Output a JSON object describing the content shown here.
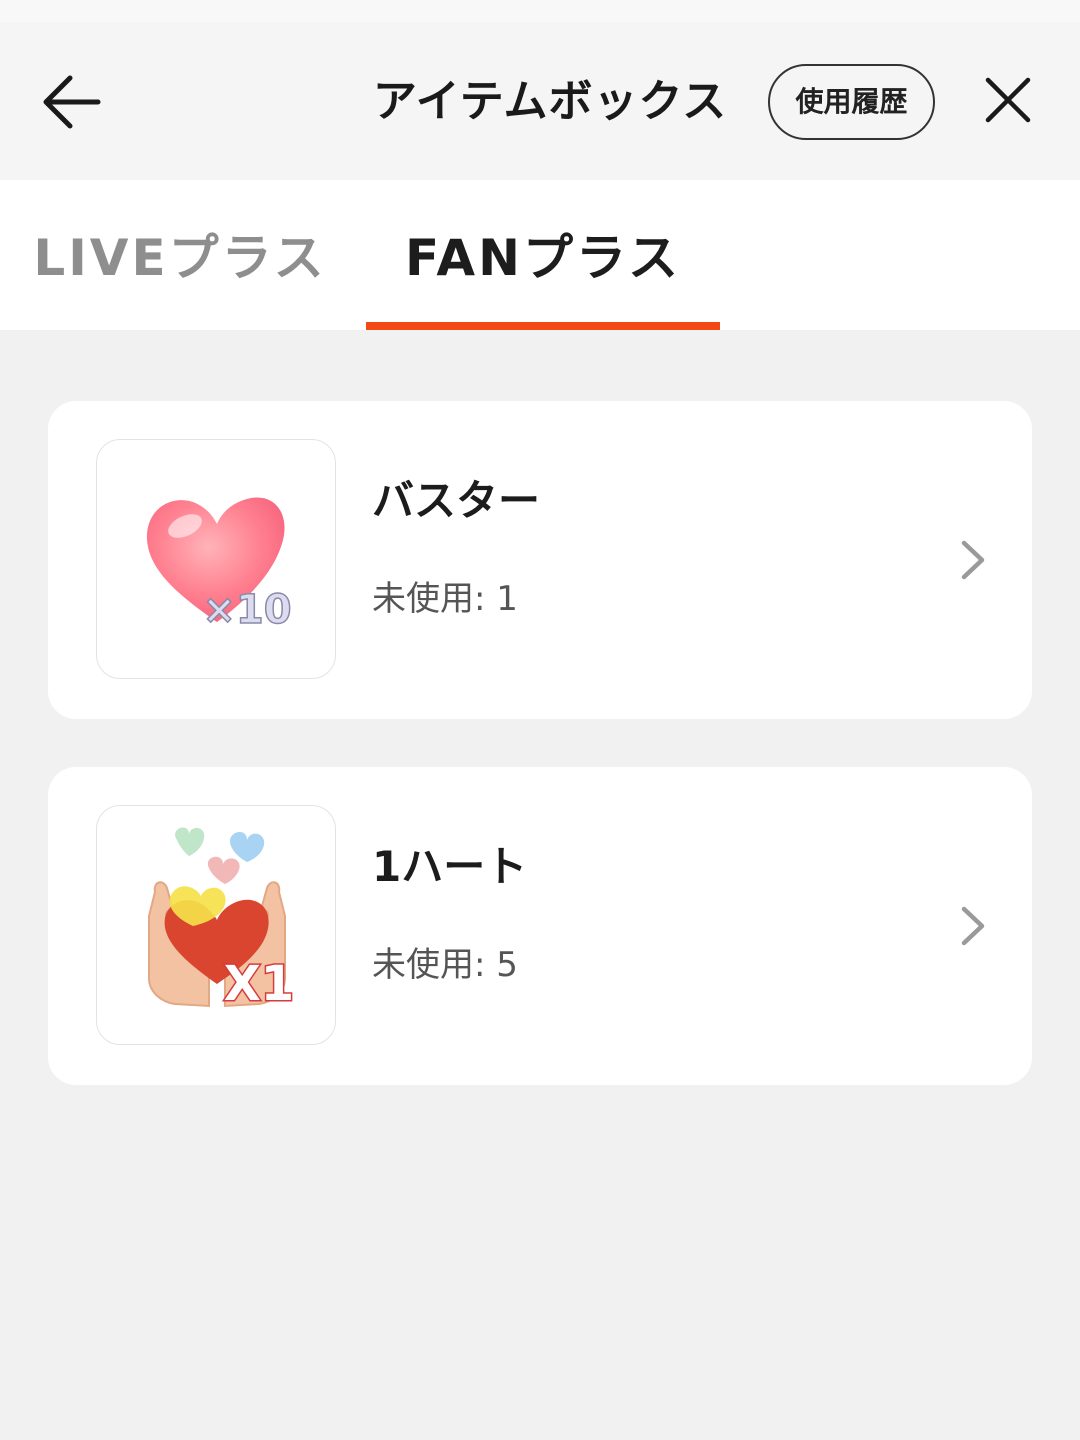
{
  "header": {
    "title": "アイテムボックス",
    "history_label": "使用履歴"
  },
  "tabs": [
    {
      "label": "LIVEプラス",
      "active": false
    },
    {
      "label": "FANプラス",
      "active": true
    }
  ],
  "accent_color": "#f24a16",
  "items": [
    {
      "name": "バスター",
      "count_label": "未使用: 1",
      "badge": "×10",
      "icon": "pink-heart-icon"
    },
    {
      "name": "1ハート",
      "count_label": "未使用: 5",
      "badge": "X1",
      "icon": "hands-holding-hearts-icon"
    }
  ]
}
